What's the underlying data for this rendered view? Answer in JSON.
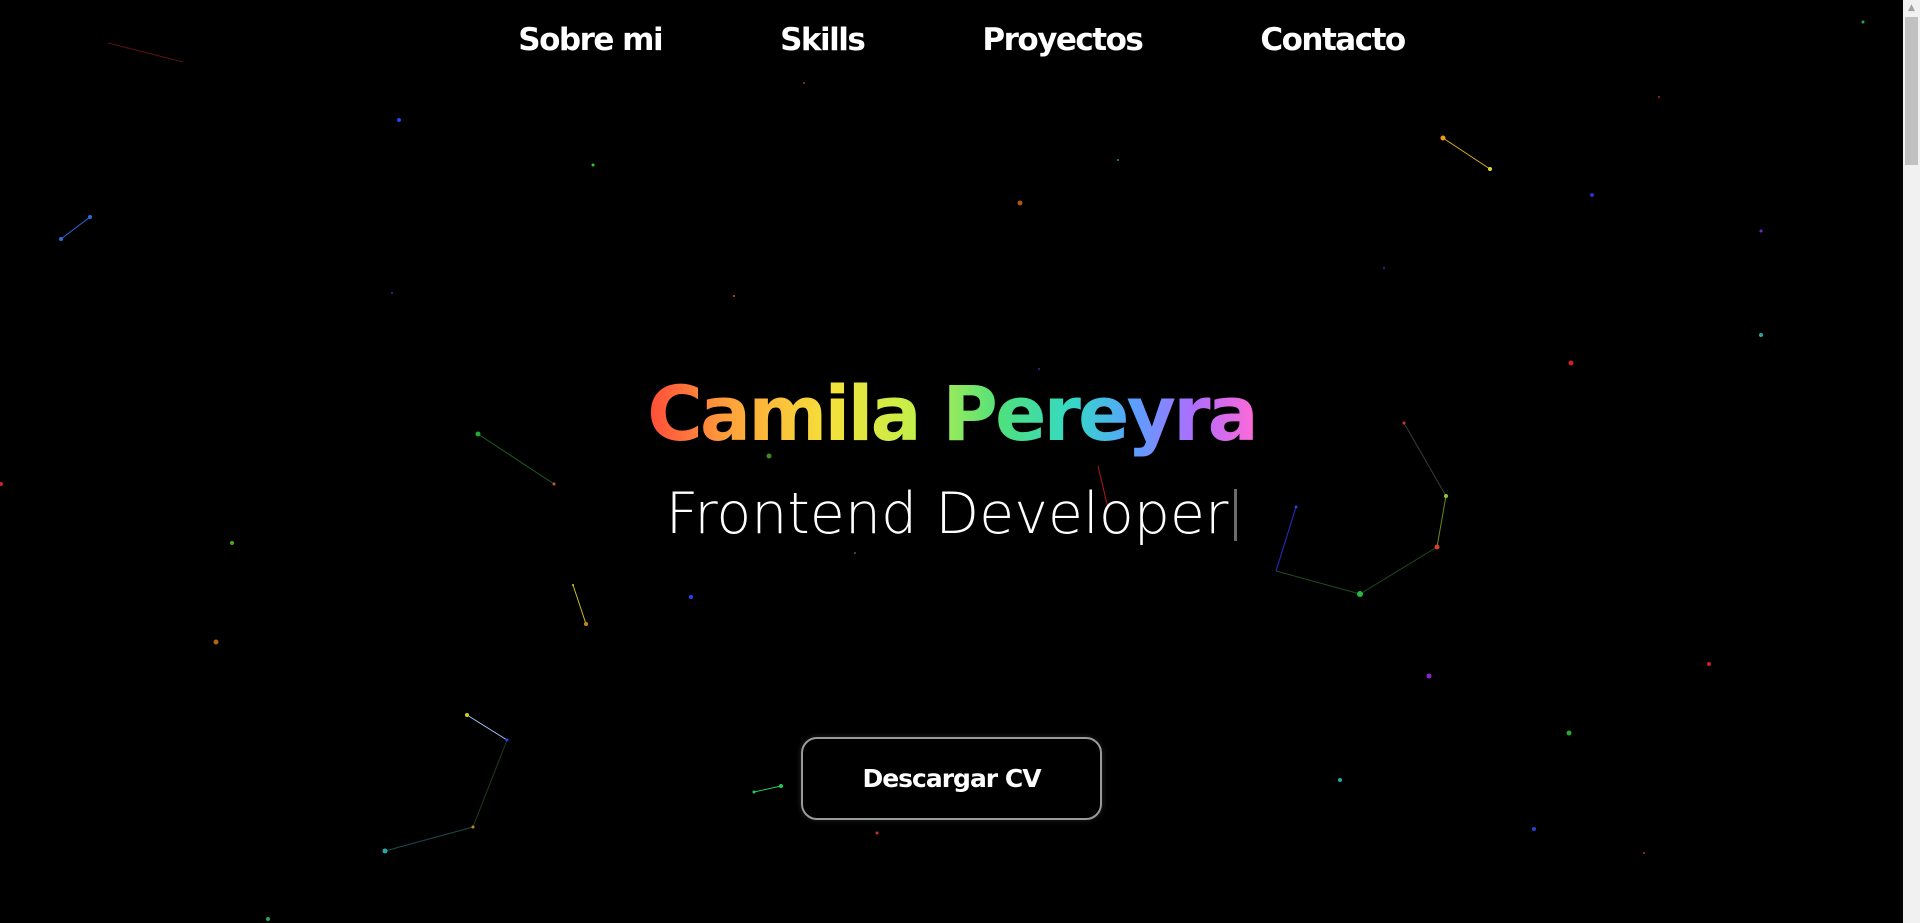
{
  "nav": {
    "items": [
      {
        "label": "Sobre mi"
      },
      {
        "label": "Skills"
      },
      {
        "label": "Proyectos"
      },
      {
        "label": "Contacto"
      }
    ]
  },
  "hero": {
    "name": "Camila Pereyra",
    "role": "Frontend Developer"
  },
  "cta": {
    "download_cv": "Descargar CV"
  },
  "colors": {
    "background": "#000000",
    "text": "#ffffff",
    "gradient": [
      "#ff4b3a",
      "#f4e23a",
      "#4fe07c",
      "#5aa0ff",
      "#b16cff",
      "#ff6ad5"
    ]
  },
  "icons": {
    "scroll_up": "triangle-up-icon"
  }
}
